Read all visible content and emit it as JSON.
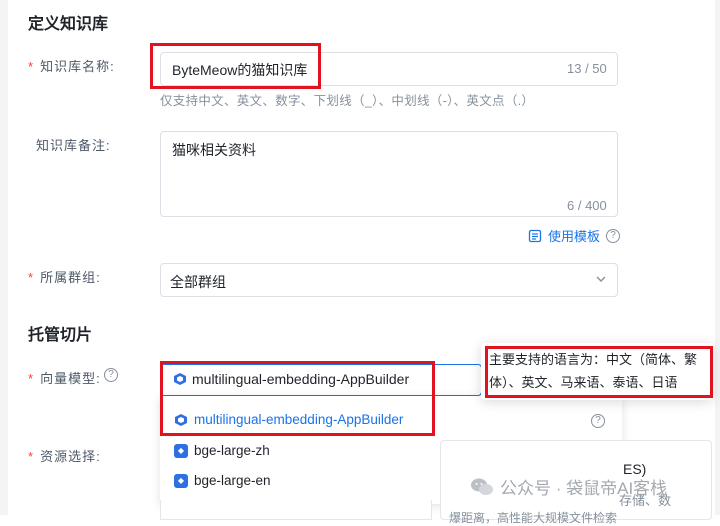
{
  "section_define": "定义知识库",
  "name_field": {
    "label": "知识库名称:",
    "value": "ByteMeow的猫知识库",
    "counter": "13 / 50",
    "hint": "仅支持中文、英文、数字、下划线（_）、中划线（-）、英文点（.）"
  },
  "note_field": {
    "label": "知识库备注:",
    "value": "猫咪相关资料",
    "counter": "6 / 400"
  },
  "use_template_label": "使用模板",
  "group_field": {
    "label": "所属群组:",
    "value": "全部群组"
  },
  "section_chunking": "托管切片",
  "vector_model": {
    "label": "向量模型:",
    "selected": "multilingual-embedding-AppBuilder",
    "options": [
      {
        "name": "multilingual-embedding-AppBuilder"
      },
      {
        "name": "bge-large-zh"
      },
      {
        "name": "bge-large-en"
      }
    ]
  },
  "tooltip_text": "主要支持的语言为：中文（简体、繁体）、英文、马来语、泰语、日语",
  "resource_field": {
    "label": "资源选择:"
  },
  "right_card_fragment_1": "ES)",
  "right_card_fragment_2": "存储、数",
  "right_card_fragment_3": "爆距离，高性能大规模文件检索",
  "watermark": "公众号 · 袋鼠帝AI客栈",
  "colors": {
    "link_blue": "#1a73e8",
    "required_red": "#f53f3f",
    "annotation_red": "#e0131e"
  },
  "icons": [
    "help-circle-icon",
    "chevron-down-icon",
    "template-icon",
    "cube-icon",
    "model-badge-icon",
    "wechat-logo-icon"
  ]
}
